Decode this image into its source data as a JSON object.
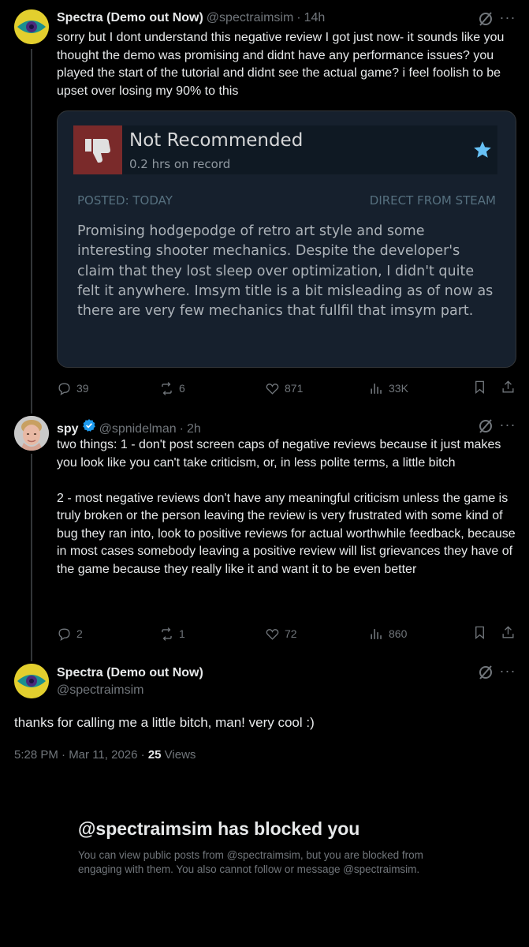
{
  "tweet1": {
    "name": "Spectra (Demo out Now)",
    "handle": "@spectraimsim",
    "time": "14h",
    "text": "sorry but I dont understand this negative review I got just now- it sounds like you thought the demo was promising and didnt have any performance issues? you played the start of the tutorial and didnt see the actual game? i feel foolish to be upset over losing my 90% to this",
    "replies": "39",
    "reposts": "6",
    "likes": "871",
    "views": "33K"
  },
  "steam_review": {
    "verdict": "Not Recommended",
    "hours": "0.2 hrs on record",
    "posted": "POSTED: TODAY",
    "source": "DIRECT FROM STEAM",
    "body": "Promising hodgepodge of retro art style and some interesting shooter mechanics. Despite the developer's claim that they lost sleep over optimization, I didn't quite felt it anywhere. Imsym title is a bit misleading as of now as there are very few mechanics that fullfil that imsym part.",
    "colors": {
      "card_bg": "#16202d",
      "header_bg": "#0f1923",
      "thumb_bg": "#7a2a2a",
      "star": "#67c1f5"
    }
  },
  "tweet2": {
    "name": "spy",
    "handle": "@spnidelman",
    "time": "2h",
    "text": "two things: 1 - don't post screen caps of negative reviews because it just makes you look like you can't take criticism, or, in less polite terms, a little bitch\n\n2 - most negative reviews don't have any meaningful criticism unless the game is truly broken or the person leaving the review is very frustrated with some kind of bug they ran into, look to positive reviews for actual worthwhile feedback, because in most cases somebody leaving a positive review will list grievances they have of the game because they really like it and want it to be even better",
    "replies": "2",
    "reposts": "1",
    "likes": "72",
    "views": "860"
  },
  "tweet3": {
    "name": "Spectra (Demo out Now)",
    "handle": "@spectraimsim",
    "text": "thanks for calling me a little bitch, man! very cool :)",
    "timestamp": "5:28 PM · Mar 11, 2026 · ",
    "views_count": "25",
    "views_label": "Views"
  },
  "blocked": {
    "title": "@spectraimsim has blocked you",
    "description": "You can view public posts from @spectraimsim, but you are blocked from engaging with them. You also cannot follow or message @spectraimsim."
  },
  "theme": {
    "background": "#000000",
    "text": "#e7e9ea",
    "muted": "#71767b",
    "verified": "#1d9bf0"
  }
}
